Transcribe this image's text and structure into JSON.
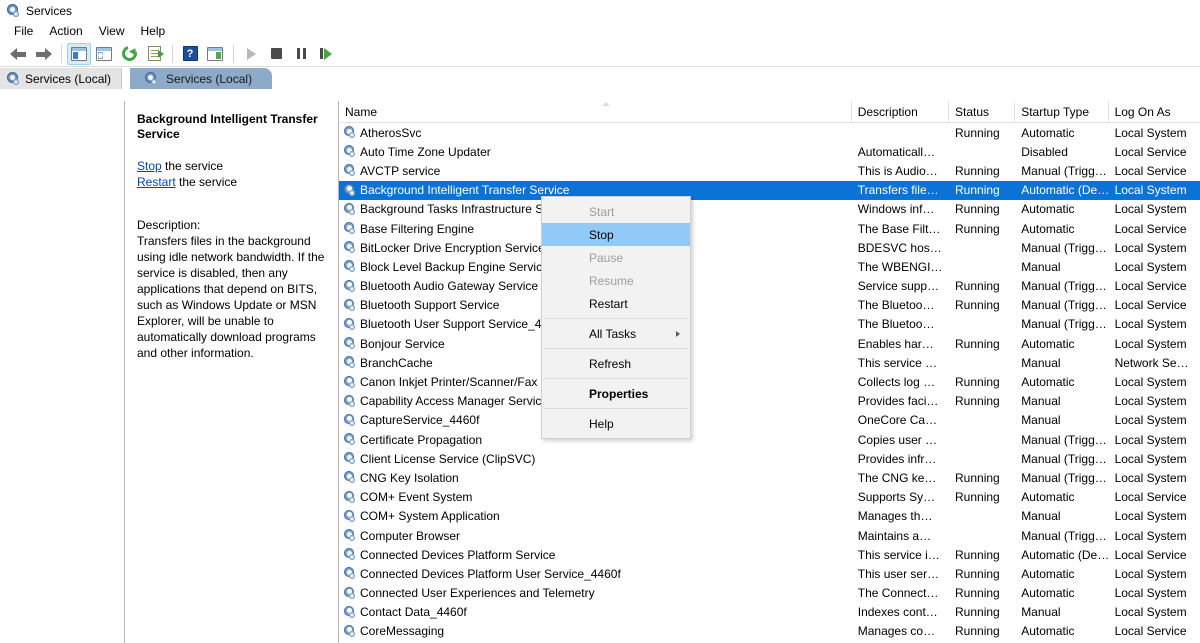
{
  "window": {
    "title": "Services",
    "icon": "services-gear-icon"
  },
  "menubar": {
    "items": [
      "File",
      "Action",
      "View",
      "Help"
    ]
  },
  "toolbar": {
    "buttons": [
      {
        "name": "back-button",
        "icon": "arrow-left-icon"
      },
      {
        "name": "forward-button",
        "icon": "arrow-right-icon"
      },
      {
        "name": "show-hide-console-tree-button",
        "icon": "console-tree-icon"
      },
      {
        "name": "show-hide-action-pane-button",
        "icon": "action-pane-icon"
      },
      {
        "name": "refresh-button",
        "icon": "refresh-icon"
      },
      {
        "name": "export-list-button",
        "icon": "export-list-icon"
      },
      {
        "name": "help-button",
        "icon": "help-icon"
      },
      {
        "name": "properties-button",
        "icon": "properties-icon"
      },
      {
        "name": "start-service-button",
        "icon": "play-icon"
      },
      {
        "name": "stop-service-button",
        "icon": "stop-icon"
      },
      {
        "name": "pause-service-button",
        "icon": "pause-icon"
      },
      {
        "name": "restart-service-button",
        "icon": "restart-icon"
      }
    ]
  },
  "tree": {
    "root_label": "Services (Local)"
  },
  "pane_tab": {
    "label": "Services (Local)"
  },
  "details": {
    "title": "Background Intelligent Transfer Service",
    "stop_link": "Stop",
    "stop_suffix": " the service",
    "restart_link": "Restart",
    "restart_suffix": " the service",
    "description_label": "Description:",
    "description_text": "Transfers files in the background using idle network bandwidth. If the service is disabled, then any applications that depend on BITS, such as Windows Update or MSN Explorer, will be unable to automatically download programs and other information."
  },
  "list": {
    "columns": [
      "Name",
      "Description",
      "Status",
      "Startup Type",
      "Log On As"
    ],
    "sort_column": "Name",
    "sort_direction": "ascending",
    "rows": [
      {
        "name": "AtherosSvc",
        "description": "",
        "status": "Running",
        "startup": "Automatic",
        "logon": "Local System",
        "selected": false
      },
      {
        "name": "Auto Time Zone Updater",
        "description": "Automaticall…",
        "status": "",
        "startup": "Disabled",
        "logon": "Local Service",
        "selected": false
      },
      {
        "name": "AVCTP service",
        "description": "This is Audio…",
        "status": "Running",
        "startup": "Manual (Trigg…",
        "logon": "Local Service",
        "selected": false
      },
      {
        "name": "Background Intelligent Transfer Service",
        "description": "Transfers file…",
        "status": "Running",
        "startup": "Automatic (De…",
        "logon": "Local System",
        "selected": true
      },
      {
        "name": "Background Tasks Infrastructure Se",
        "description": "Windows inf…",
        "status": "Running",
        "startup": "Automatic",
        "logon": "Local System",
        "selected": false
      },
      {
        "name": "Base Filtering Engine",
        "description": "The Base Filt…",
        "status": "Running",
        "startup": "Automatic",
        "logon": "Local Service",
        "selected": false
      },
      {
        "name": "BitLocker Drive Encryption Service",
        "description": "BDESVC hos…",
        "status": "",
        "startup": "Manual (Trigg…",
        "logon": "Local System",
        "selected": false
      },
      {
        "name": "Block Level Backup Engine Service",
        "description": "The WBENGI…",
        "status": "",
        "startup": "Manual",
        "logon": "Local System",
        "selected": false
      },
      {
        "name": "Bluetooth Audio Gateway Service",
        "description": "Service supp…",
        "status": "Running",
        "startup": "Manual (Trigg…",
        "logon": "Local Service",
        "selected": false
      },
      {
        "name": "Bluetooth Support Service",
        "description": "The Bluetoo…",
        "status": "Running",
        "startup": "Manual (Trigg…",
        "logon": "Local Service",
        "selected": false
      },
      {
        "name": "Bluetooth User Support Service_4460f",
        "description": "The Bluetoo…",
        "status": "",
        "startup": "Manual (Trigg…",
        "logon": "Local System",
        "selected": false
      },
      {
        "name": "Bonjour Service",
        "description": "Enables har…",
        "status": "Running",
        "startup": "Automatic",
        "logon": "Local System",
        "selected": false
      },
      {
        "name": "BranchCache",
        "description": "This service …",
        "status": "",
        "startup": "Manual",
        "logon": "Network Se…",
        "selected": false
      },
      {
        "name": "Canon Inkjet Printer/Scanner/Fax Ex",
        "description": "Collects log …",
        "status": "Running",
        "startup": "Automatic",
        "logon": "Local System",
        "selected": false
      },
      {
        "name": "Capability Access Manager Service",
        "description": "Provides faci…",
        "status": "Running",
        "startup": "Manual",
        "logon": "Local System",
        "selected": false
      },
      {
        "name": "CaptureService_4460f",
        "description": "OneCore Ca…",
        "status": "",
        "startup": "Manual",
        "logon": "Local System",
        "selected": false
      },
      {
        "name": "Certificate Propagation",
        "description": "Copies user …",
        "status": "",
        "startup": "Manual (Trigg…",
        "logon": "Local System",
        "selected": false
      },
      {
        "name": "Client License Service (ClipSVC)",
        "description": "Provides infr…",
        "status": "",
        "startup": "Manual (Trigg…",
        "logon": "Local System",
        "selected": false
      },
      {
        "name": "CNG Key Isolation",
        "description": "The CNG ke…",
        "status": "Running",
        "startup": "Manual (Trigg…",
        "logon": "Local System",
        "selected": false
      },
      {
        "name": "COM+ Event System",
        "description": "Supports Sy…",
        "status": "Running",
        "startup": "Automatic",
        "logon": "Local Service",
        "selected": false
      },
      {
        "name": "COM+ System Application",
        "description": "Manages th…",
        "status": "",
        "startup": "Manual",
        "logon": "Local System",
        "selected": false
      },
      {
        "name": "Computer Browser",
        "description": "Maintains a…",
        "status": "",
        "startup": "Manual (Trigg…",
        "logon": "Local System",
        "selected": false
      },
      {
        "name": "Connected Devices Platform Service",
        "description": "This service i…",
        "status": "Running",
        "startup": "Automatic (De…",
        "logon": "Local Service",
        "selected": false
      },
      {
        "name": "Connected Devices Platform User Service_4460f",
        "description": "This user ser…",
        "status": "Running",
        "startup": "Automatic",
        "logon": "Local System",
        "selected": false
      },
      {
        "name": "Connected User Experiences and Telemetry",
        "description": "The Connect…",
        "status": "Running",
        "startup": "Automatic",
        "logon": "Local System",
        "selected": false
      },
      {
        "name": "Contact Data_4460f",
        "description": "Indexes cont…",
        "status": "Running",
        "startup": "Manual",
        "logon": "Local System",
        "selected": false
      },
      {
        "name": "CoreMessaging",
        "description": "Manages co…",
        "status": "Running",
        "startup": "Automatic",
        "logon": "Local Service",
        "selected": false
      }
    ]
  },
  "context_menu": {
    "items": [
      {
        "label": "Start",
        "state": "disabled"
      },
      {
        "label": "Stop",
        "state": "highlighted"
      },
      {
        "label": "Pause",
        "state": "disabled"
      },
      {
        "label": "Resume",
        "state": "disabled"
      },
      {
        "label": "Restart",
        "state": "normal"
      },
      {
        "separator": true
      },
      {
        "label": "All Tasks",
        "state": "submenu"
      },
      {
        "separator": true
      },
      {
        "label": "Refresh",
        "state": "normal"
      },
      {
        "separator": true
      },
      {
        "label": "Properties",
        "state": "bold"
      },
      {
        "separator": true
      },
      {
        "label": "Help",
        "state": "normal"
      }
    ]
  },
  "colors": {
    "selection_blue": "#0b72d6",
    "menu_highlight": "#91c9f7",
    "tab_blue": "#8daac8",
    "link_blue": "#0645ad"
  }
}
